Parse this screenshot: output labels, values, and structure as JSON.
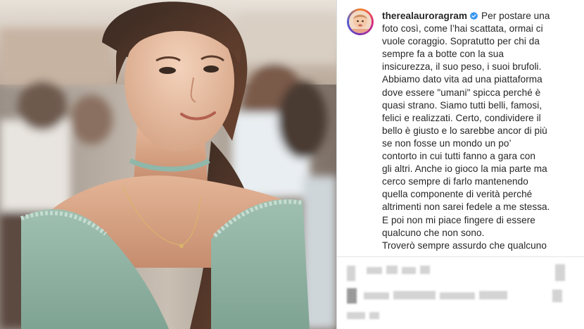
{
  "post": {
    "username": "therealauroragram",
    "verified": true,
    "caption_lines": [
      "Per postare una",
      "foto così, come l’hai scattata, ormai ci",
      "vuole coraggio. Sopratutto per chi da",
      "sempre fa a botte con la sua",
      "insicurezza, il suo peso, i suoi brufoli.",
      "Abbiamo dato vita ad una piattaforma",
      "dove essere \"umani\" spicca perché è",
      "quasi strano. Siamo tutti belli, famosi,",
      "felici e realizzati. Certo, condividere il",
      "bello è giusto e lo sarebbe ancor di più",
      "se non fosse un mondo un po’",
      "contorto in cui tutti fanno a gara con",
      "gli altri. Anche io gioco la mia parte ma",
      "cerco sempre di farlo mantenendo",
      "quella componente di verità perché",
      "altrimenti non sarei fedele a me stessa.",
      "E poi non mi piace fingere di essere",
      "qualcuno che non sono.",
      "Troverò sempre assurdo che qualcuno"
    ]
  },
  "colors": {
    "text": "#262626",
    "verified_badge": "#3897f0",
    "divider": "#e6e6e6"
  },
  "icons": {
    "verified": "verified-badge-icon",
    "avatar": "profile-avatar"
  }
}
